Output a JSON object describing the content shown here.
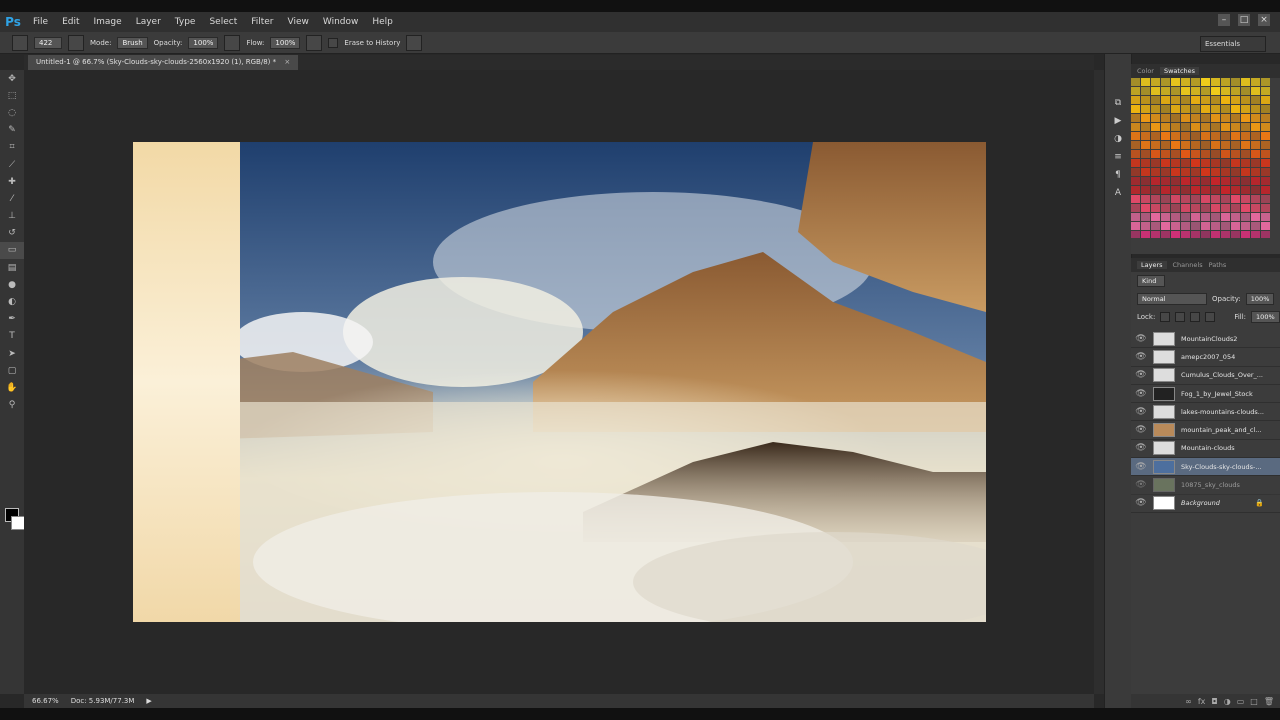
{
  "app": {
    "logo": "Ps"
  },
  "menu": [
    "File",
    "Edit",
    "Image",
    "Layer",
    "Type",
    "Select",
    "Filter",
    "View",
    "Window",
    "Help"
  ],
  "options": {
    "brush_size": "422",
    "mode_label": "Mode:",
    "mode_value": "Brush",
    "opacity_label": "Opacity:",
    "opacity_value": "100%",
    "flow_label": "Flow:",
    "flow_value": "100%",
    "erase_history_label": "Erase to History"
  },
  "workspace": "Essentials",
  "document_tab": {
    "title": "Untitled-1 @ 66.7% (Sky-Clouds-sky-clouds-2560x1920 (1), RGB/8) *",
    "close": "×"
  },
  "status": {
    "zoom": "66.67%",
    "doc": "Doc: 5.93M/77.3M"
  },
  "swatch_panel": {
    "tabs": [
      "Color",
      "Swatches"
    ]
  },
  "layers_panel": {
    "tabs": [
      "Layers",
      "Channels",
      "Paths"
    ],
    "kind": "Kind",
    "blend_mode": "Normal",
    "opacity_label": "Opacity:",
    "opacity_value": "100%",
    "lock_label": "Lock:",
    "fill_label": "Fill:",
    "fill_value": "100%",
    "layers": [
      {
        "name": "MountainClouds2"
      },
      {
        "name": "amepc2007_054"
      },
      {
        "name": "Cumulus_Clouds_Over_..."
      },
      {
        "name": "Fog_1_by_Jewel_Stock"
      },
      {
        "name": "lakes-mountains-clouds..."
      },
      {
        "name": "mountain_peak_and_cl..."
      },
      {
        "name": "Mountain-clouds"
      },
      {
        "name": "Sky-Clouds-sky-clouds-..."
      },
      {
        "name": "10875_sky_clouds"
      },
      {
        "name": "Background"
      }
    ]
  },
  "colors": {
    "accent": "#2fa3e6",
    "selection": "#5a6a80"
  }
}
